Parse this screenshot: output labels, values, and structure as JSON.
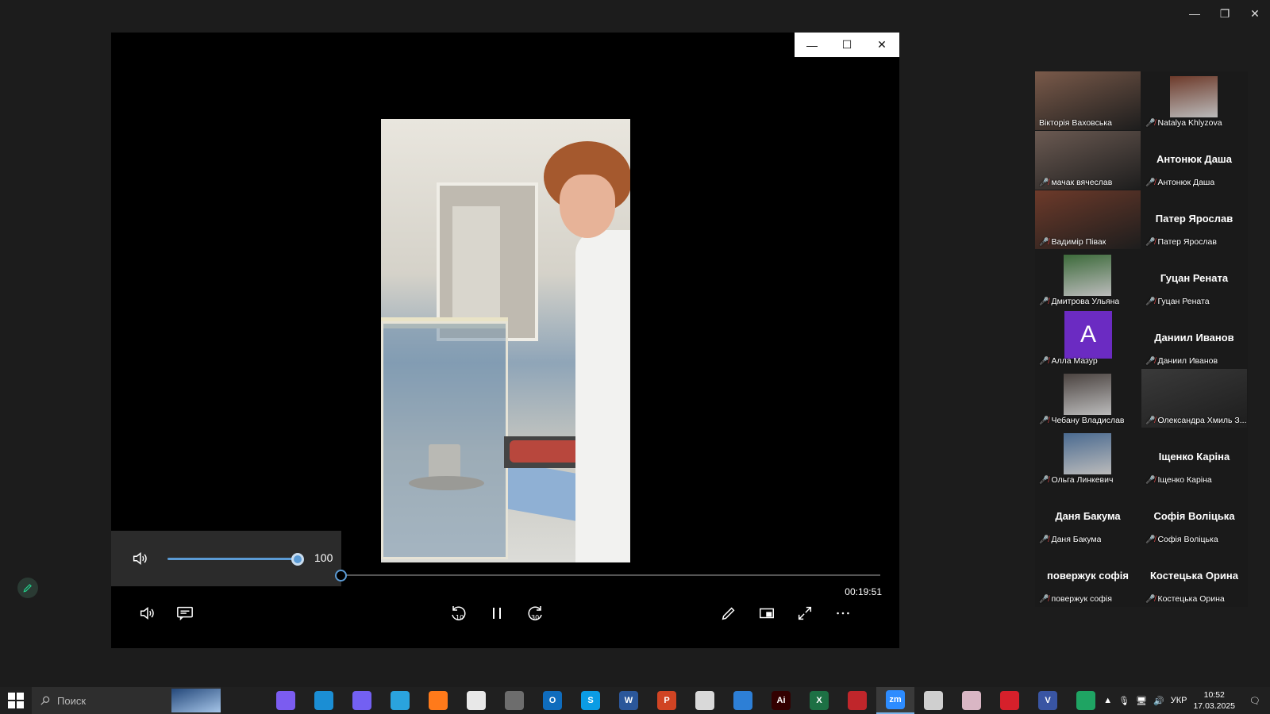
{
  "window_controls": {
    "minimize": "—",
    "restore": "❐",
    "close": "✕"
  },
  "player": {
    "titlebar": {
      "minimize": "—",
      "maximize": "☐",
      "close": "✕"
    },
    "volume": {
      "value": "100",
      "level": 1.0
    },
    "progress": {
      "fraction": 0.0,
      "time_remaining": "00:19:51"
    },
    "skip_back_seconds": "10",
    "skip_forward_seconds": "30",
    "icons": {
      "volume": "speaker-icon",
      "captions": "captions-icon",
      "skip_back": "rewind-10-icon",
      "pause": "pause-icon",
      "skip_forward": "forward-30-icon",
      "pen": "pen-icon",
      "miniplayer": "miniplayer-icon",
      "fullscreen": "fullscreen-icon",
      "more": "more-icon"
    }
  },
  "participants": [
    {
      "name": "Вікторія Ваховська",
      "muted": false,
      "kind": "video",
      "active": true
    },
    {
      "name": "Natalya Khlyzova",
      "muted": true,
      "kind": "photo"
    },
    {
      "name": "мачак вячеслав",
      "muted": true,
      "kind": "video"
    },
    {
      "name": "Антонюк Даша",
      "muted": true,
      "kind": "text",
      "big": "Антонюк Даша"
    },
    {
      "name": "Вадимір Півак",
      "muted": true,
      "kind": "video"
    },
    {
      "name": "Патер Ярослав",
      "muted": true,
      "kind": "text",
      "big": "Патер Ярослав"
    },
    {
      "name": "Дмитрова Ульяна",
      "muted": true,
      "kind": "photo"
    },
    {
      "name": "Гуцан Рената",
      "muted": true,
      "kind": "text",
      "big": "Гуцан Рената"
    },
    {
      "name": "Алла Мазур",
      "muted": true,
      "kind": "avatar",
      "letter": "A"
    },
    {
      "name": "Даниил Иванов",
      "muted": true,
      "kind": "text",
      "big": "Даниил Иванов"
    },
    {
      "name": "Чебану Владислав",
      "muted": true,
      "kind": "photo"
    },
    {
      "name": "Олександра Хмиль З...",
      "muted": true,
      "kind": "video"
    },
    {
      "name": "Ольга Линкевич",
      "muted": true,
      "kind": "photo"
    },
    {
      "name": "Іщенко Каріна",
      "muted": true,
      "kind": "text",
      "big": "Іщенко Каріна"
    },
    {
      "name": "Даня Бакума",
      "muted": true,
      "kind": "text",
      "big": "Даня Бакума"
    },
    {
      "name": "Софія Воліцька",
      "muted": true,
      "kind": "text",
      "big": "Софія Воліцька"
    },
    {
      "name": "повержук софія",
      "muted": true,
      "kind": "text",
      "big": "повержук софія"
    },
    {
      "name": "Костецька Орина",
      "muted": true,
      "kind": "text",
      "big": "Костецька Орина"
    }
  ],
  "taskbar": {
    "search_placeholder": "Поиск",
    "apps": [
      {
        "icon": "task-view-icon",
        "label": "",
        "color": "#202020"
      },
      {
        "icon": "copilot-icon",
        "label": "",
        "color": "#7b5cf0"
      },
      {
        "icon": "edge-icon",
        "label": "",
        "color": "#1b8ed4"
      },
      {
        "icon": "viber-icon",
        "label": "",
        "color": "#7360f2"
      },
      {
        "icon": "telegram-icon",
        "label": "",
        "color": "#2aa3de"
      },
      {
        "icon": "firefox-icon",
        "label": "",
        "color": "#ff7a1a"
      },
      {
        "icon": "file-icon",
        "label": "",
        "color": "#e8e8e8"
      },
      {
        "icon": "calculator-icon",
        "label": "",
        "color": "#6d6d6d"
      },
      {
        "icon": "outlook-icon",
        "label": "O",
        "color": "#0f6cbd"
      },
      {
        "icon": "skype-icon",
        "label": "S",
        "color": "#0b9ce4"
      },
      {
        "icon": "word-icon",
        "label": "W",
        "color": "#2b579a"
      },
      {
        "icon": "powerpoint-icon",
        "label": "P",
        "color": "#d04423"
      },
      {
        "icon": "clapperboard-icon",
        "label": "",
        "color": "#d9d9d9"
      },
      {
        "icon": "calendar-icon",
        "label": "",
        "color": "#2d7fd6"
      },
      {
        "icon": "illustrator-icon",
        "label": "Ai",
        "color": "#330000"
      },
      {
        "icon": "excel-icon",
        "label": "X",
        "color": "#1d7044"
      },
      {
        "icon": "red-app-icon",
        "label": "",
        "color": "#c0262b"
      },
      {
        "icon": "zoom-icon",
        "label": "zm",
        "color": "#2d8cff",
        "active": true
      },
      {
        "icon": "scanner-icon",
        "label": "",
        "color": "#cfcfcf"
      },
      {
        "icon": "brain-icon",
        "label": "",
        "color": "#d9b6c4"
      },
      {
        "icon": "opera-icon",
        "label": "",
        "color": "#d6202b"
      },
      {
        "icon": "visio-icon",
        "label": "V",
        "color": "#3955a3"
      },
      {
        "icon": "drive-icon",
        "label": "",
        "color": "#1fa463"
      }
    ],
    "tray": {
      "language": "УКР",
      "time": "10:52",
      "date": "17.03.2025"
    }
  }
}
